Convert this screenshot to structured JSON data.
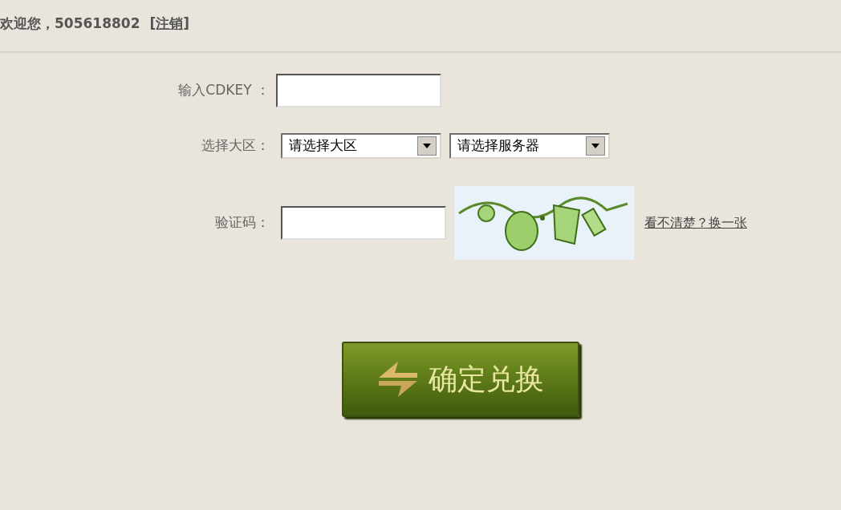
{
  "header": {
    "welcome": "欢迎您，505618802",
    "logout_link": "[注销]"
  },
  "form": {
    "cdkey": {
      "label": "输入CDKEY ："
    },
    "region": {
      "label": "选择大区：",
      "dropdowns": [
        {
          "value": "请选择大区"
        },
        {
          "value": "请选择服务器"
        }
      ]
    },
    "captcha": {
      "label": "验证码：",
      "refresh_link": "看不清楚？换一张"
    }
  },
  "submit_button": "确定兑换"
}
